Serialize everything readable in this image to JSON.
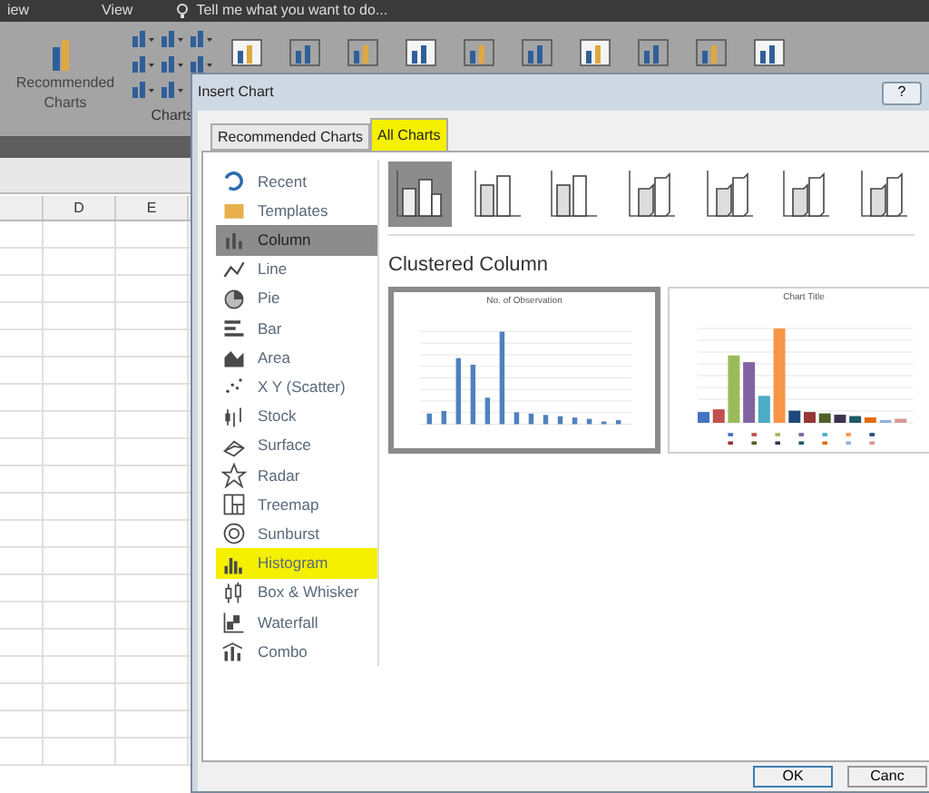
{
  "app": {
    "menu_tabs": [
      "iew",
      "View"
    ],
    "tell_me": "Tell me what you want to do...",
    "ribbon": {
      "recommended": "Recommended Charts",
      "group_label": "Charts"
    },
    "columns": [
      "D",
      "E"
    ]
  },
  "dialog": {
    "title": "Insert Chart",
    "help": "?",
    "tabs": [
      {
        "label": "Recommended Charts",
        "selected": false,
        "highlighted": false
      },
      {
        "label": "All Charts",
        "selected": true,
        "highlighted": true
      }
    ],
    "chart_types": [
      {
        "label": "Recent",
        "selected": false,
        "highlighted": false
      },
      {
        "label": "Templates",
        "selected": false,
        "highlighted": false
      },
      {
        "label": "Column",
        "selected": true,
        "highlighted": false
      },
      {
        "label": "Line",
        "selected": false,
        "highlighted": false
      },
      {
        "label": "Pie",
        "selected": false,
        "highlighted": false
      },
      {
        "label": "Bar",
        "selected": false,
        "highlighted": false
      },
      {
        "label": "Area",
        "selected": false,
        "highlighted": false
      },
      {
        "label": "X Y (Scatter)",
        "selected": false,
        "highlighted": false
      },
      {
        "label": "Stock",
        "selected": false,
        "highlighted": false
      },
      {
        "label": "Surface",
        "selected": false,
        "highlighted": false
      },
      {
        "label": "Radar",
        "selected": false,
        "highlighted": false
      },
      {
        "label": "Treemap",
        "selected": false,
        "highlighted": false
      },
      {
        "label": "Sunburst",
        "selected": false,
        "highlighted": false
      },
      {
        "label": "Histogram",
        "selected": false,
        "highlighted": true
      },
      {
        "label": "Box & Whisker",
        "selected": false,
        "highlighted": false
      },
      {
        "label": "Waterfall",
        "selected": false,
        "highlighted": false
      },
      {
        "label": "Combo",
        "selected": false,
        "highlighted": false
      }
    ],
    "subtypes": [
      {
        "selected": true
      },
      {
        "selected": false
      },
      {
        "selected": false
      },
      {
        "selected": false
      },
      {
        "selected": false
      },
      {
        "selected": false
      },
      {
        "selected": false
      }
    ],
    "subtype_title": "Clustered Column",
    "previews": [
      {
        "title": "No. of Observation",
        "selected": true,
        "kind": "single"
      },
      {
        "title": "Chart Title",
        "selected": false,
        "kind": "multi"
      }
    ],
    "buttons": [
      "OK",
      "Canc"
    ]
  }
}
